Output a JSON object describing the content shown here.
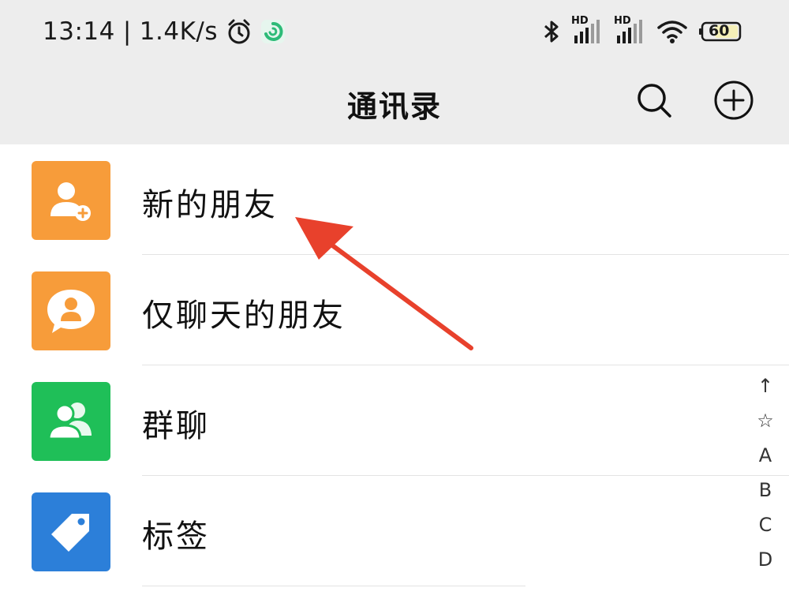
{
  "status_bar": {
    "time": "13:14",
    "separator": "|",
    "network_speed": "1.4K/s",
    "signal1_label": "HD",
    "signal2_label": "HD",
    "battery": "60",
    "icons": [
      "alarm-icon",
      "app-notification-icon",
      "bluetooth-icon",
      "signal-icon",
      "wifi-icon",
      "battery-icon"
    ]
  },
  "navbar": {
    "title": "通讯录",
    "search_icon": "search-icon",
    "add_icon": "add-circle-icon"
  },
  "contacts_menu": [
    {
      "label": "新的朋友",
      "icon": "add-friend-icon",
      "color": "#f79c3a"
    },
    {
      "label": "仅聊天的朋友",
      "icon": "chat-only-friend-icon",
      "color": "#f79c3a"
    },
    {
      "label": "群聊",
      "icon": "group-chat-icon",
      "color": "#1fbf58"
    },
    {
      "label": "标签",
      "icon": "tag-icon",
      "color": "#2c7fd9"
    }
  ],
  "index_bar": [
    "↑",
    "☆",
    "A",
    "B",
    "C",
    "D"
  ],
  "colors": {
    "header_bg": "#ededed",
    "annotation_arrow": "#e8412c"
  }
}
